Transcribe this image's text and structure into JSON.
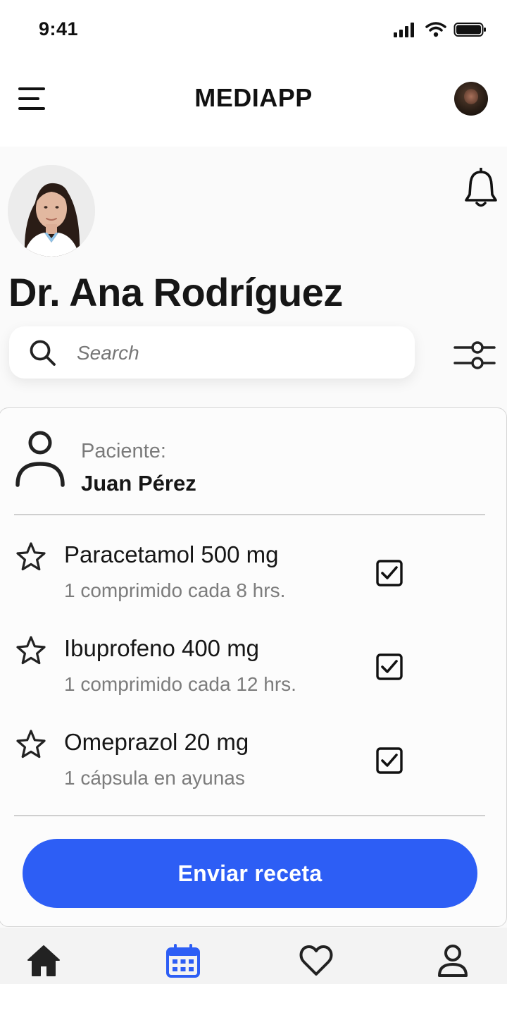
{
  "status_bar": {
    "time": "9:41"
  },
  "header": {
    "app_title": "MEDIAPP"
  },
  "profile": {
    "doctor_name": "Dr. Ana Rodríguez"
  },
  "search": {
    "placeholder": "Search"
  },
  "prescription": {
    "patient_label": "Paciente:",
    "patient_name": "Juan Pérez",
    "medications": [
      {
        "name": "Paracetamol 500 mg",
        "dose": "1 comprimido cada 8 hrs.",
        "checked": true,
        "starred": false
      },
      {
        "name": "Ibuprofeno 400 mg",
        "dose": "1 comprimido cada 12 hrs.",
        "checked": true,
        "starred": false
      },
      {
        "name": "Omeprazol 20 mg",
        "dose": "1 cápsula en ayunas",
        "checked": true,
        "starred": false
      }
    ],
    "send_label": "Enviar receta"
  },
  "bottom_nav": {
    "items": [
      {
        "icon": "home-icon",
        "active": false
      },
      {
        "icon": "calendar-icon",
        "active": true
      },
      {
        "icon": "heart-icon",
        "active": false
      },
      {
        "icon": "user-icon",
        "active": false
      }
    ]
  },
  "colors": {
    "accent": "#2d5ef5",
    "text": "#161616",
    "muted": "#7c7c7c",
    "divider": "#cfcfcf"
  }
}
